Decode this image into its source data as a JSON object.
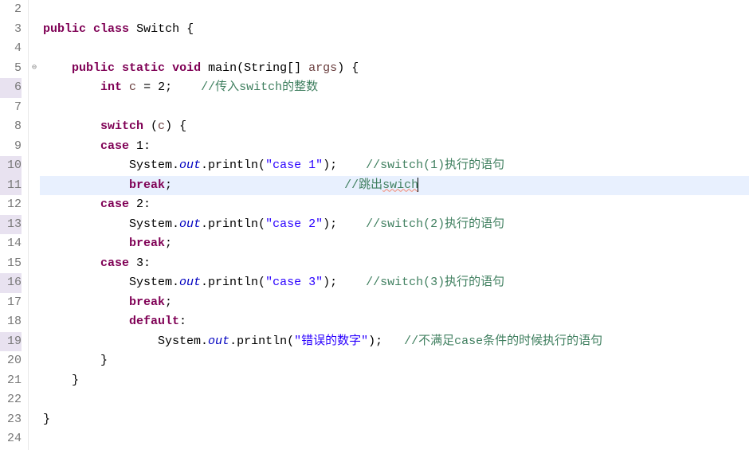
{
  "lines": [
    {
      "num": "2",
      "hl": false,
      "marker": "",
      "current": false,
      "tokens": [
        {
          "t": "plain",
          "s": ""
        }
      ]
    },
    {
      "num": "3",
      "hl": false,
      "marker": "",
      "current": false,
      "tokens": [
        {
          "t": "kw",
          "s": "public"
        },
        {
          "t": "plain",
          "s": " "
        },
        {
          "t": "kw",
          "s": "class"
        },
        {
          "t": "plain",
          "s": " "
        },
        {
          "t": "cls",
          "s": "Switch"
        },
        {
          "t": "plain",
          "s": " {"
        }
      ]
    },
    {
      "num": "4",
      "hl": false,
      "marker": "",
      "current": false,
      "tokens": [
        {
          "t": "plain",
          "s": ""
        }
      ]
    },
    {
      "num": "5",
      "hl": false,
      "marker": "⊖",
      "current": false,
      "tokens": [
        {
          "t": "plain",
          "s": "    "
        },
        {
          "t": "kw",
          "s": "public"
        },
        {
          "t": "plain",
          "s": " "
        },
        {
          "t": "kw",
          "s": "static"
        },
        {
          "t": "plain",
          "s": " "
        },
        {
          "t": "kw",
          "s": "void"
        },
        {
          "t": "plain",
          "s": " "
        },
        {
          "t": "mtd",
          "s": "main"
        },
        {
          "t": "plain",
          "s": "("
        },
        {
          "t": "cls",
          "s": "String"
        },
        {
          "t": "plain",
          "s": "[] "
        },
        {
          "t": "var",
          "s": "args"
        },
        {
          "t": "plain",
          "s": ") {"
        }
      ]
    },
    {
      "num": "6",
      "hl": true,
      "marker": "",
      "current": false,
      "tokens": [
        {
          "t": "plain",
          "s": "        "
        },
        {
          "t": "kw",
          "s": "int"
        },
        {
          "t": "plain",
          "s": " "
        },
        {
          "t": "var",
          "s": "c"
        },
        {
          "t": "plain",
          "s": " = 2;    "
        },
        {
          "t": "cmt",
          "s": "//传入switch的整数"
        }
      ]
    },
    {
      "num": "7",
      "hl": false,
      "marker": "",
      "current": false,
      "tokens": [
        {
          "t": "plain",
          "s": ""
        }
      ]
    },
    {
      "num": "8",
      "hl": false,
      "marker": "",
      "current": false,
      "tokens": [
        {
          "t": "plain",
          "s": "        "
        },
        {
          "t": "kw",
          "s": "switch"
        },
        {
          "t": "plain",
          "s": " ("
        },
        {
          "t": "var",
          "s": "c"
        },
        {
          "t": "plain",
          "s": ") {"
        }
      ]
    },
    {
      "num": "9",
      "hl": false,
      "marker": "",
      "current": false,
      "tokens": [
        {
          "t": "plain",
          "s": "        "
        },
        {
          "t": "kw",
          "s": "case"
        },
        {
          "t": "plain",
          "s": " 1:"
        }
      ]
    },
    {
      "num": "10",
      "hl": true,
      "marker": "",
      "current": false,
      "tokens": [
        {
          "t": "plain",
          "s": "            System."
        },
        {
          "t": "field",
          "s": "out"
        },
        {
          "t": "plain",
          "s": ".println("
        },
        {
          "t": "str",
          "s": "\"case 1\""
        },
        {
          "t": "plain",
          "s": ");    "
        },
        {
          "t": "cmt",
          "s": "//switch(1)执行的语句"
        }
      ]
    },
    {
      "num": "11",
      "hl": true,
      "marker": "",
      "current": true,
      "tokens": [
        {
          "t": "plain",
          "s": "            "
        },
        {
          "t": "kw",
          "s": "break"
        },
        {
          "t": "plain",
          "s": ";                        "
        },
        {
          "t": "cmt",
          "s": "//跳出"
        },
        {
          "t": "cmt wavy",
          "s": "swich"
        },
        {
          "t": "cursor",
          "s": ""
        }
      ]
    },
    {
      "num": "12",
      "hl": false,
      "marker": "",
      "current": false,
      "tokens": [
        {
          "t": "plain",
          "s": "        "
        },
        {
          "t": "kw",
          "s": "case"
        },
        {
          "t": "plain",
          "s": " 2:"
        }
      ]
    },
    {
      "num": "13",
      "hl": true,
      "marker": "",
      "current": false,
      "tokens": [
        {
          "t": "plain",
          "s": "            System."
        },
        {
          "t": "field",
          "s": "out"
        },
        {
          "t": "plain",
          "s": ".println("
        },
        {
          "t": "str",
          "s": "\"case 2\""
        },
        {
          "t": "plain",
          "s": ");    "
        },
        {
          "t": "cmt",
          "s": "//switch(2)执行的语句"
        }
      ]
    },
    {
      "num": "14",
      "hl": false,
      "marker": "",
      "current": false,
      "tokens": [
        {
          "t": "plain",
          "s": "            "
        },
        {
          "t": "kw",
          "s": "break"
        },
        {
          "t": "plain",
          "s": ";"
        }
      ]
    },
    {
      "num": "15",
      "hl": false,
      "marker": "",
      "current": false,
      "tokens": [
        {
          "t": "plain",
          "s": "        "
        },
        {
          "t": "kw",
          "s": "case"
        },
        {
          "t": "plain",
          "s": " 3:"
        }
      ]
    },
    {
      "num": "16",
      "hl": true,
      "marker": "",
      "current": false,
      "tokens": [
        {
          "t": "plain",
          "s": "            System."
        },
        {
          "t": "field",
          "s": "out"
        },
        {
          "t": "plain",
          "s": ".println("
        },
        {
          "t": "str",
          "s": "\"case 3\""
        },
        {
          "t": "plain",
          "s": ");    "
        },
        {
          "t": "cmt",
          "s": "//switch(3)执行的语句"
        }
      ]
    },
    {
      "num": "17",
      "hl": false,
      "marker": "",
      "current": false,
      "tokens": [
        {
          "t": "plain",
          "s": "            "
        },
        {
          "t": "kw",
          "s": "break"
        },
        {
          "t": "plain",
          "s": ";"
        }
      ]
    },
    {
      "num": "18",
      "hl": false,
      "marker": "",
      "current": false,
      "tokens": [
        {
          "t": "plain",
          "s": "            "
        },
        {
          "t": "kw",
          "s": "default"
        },
        {
          "t": "plain",
          "s": ":"
        }
      ]
    },
    {
      "num": "19",
      "hl": true,
      "marker": "",
      "current": false,
      "tokens": [
        {
          "t": "plain",
          "s": "                System."
        },
        {
          "t": "field",
          "s": "out"
        },
        {
          "t": "plain",
          "s": ".println("
        },
        {
          "t": "str",
          "s": "\"错误的数字\""
        },
        {
          "t": "plain",
          "s": ");   "
        },
        {
          "t": "cmt",
          "s": "//不满足case条件的时候执行的语句"
        }
      ]
    },
    {
      "num": "20",
      "hl": false,
      "marker": "",
      "current": false,
      "tokens": [
        {
          "t": "plain",
          "s": "        }"
        }
      ]
    },
    {
      "num": "21",
      "hl": false,
      "marker": "",
      "current": false,
      "tokens": [
        {
          "t": "plain",
          "s": "    }"
        }
      ]
    },
    {
      "num": "22",
      "hl": false,
      "marker": "",
      "current": false,
      "tokens": [
        {
          "t": "plain",
          "s": ""
        }
      ]
    },
    {
      "num": "23",
      "hl": false,
      "marker": "",
      "current": false,
      "tokens": [
        {
          "t": "plain",
          "s": "}"
        }
      ]
    },
    {
      "num": "24",
      "hl": false,
      "marker": "",
      "current": false,
      "tokens": [
        {
          "t": "plain",
          "s": ""
        }
      ]
    }
  ]
}
